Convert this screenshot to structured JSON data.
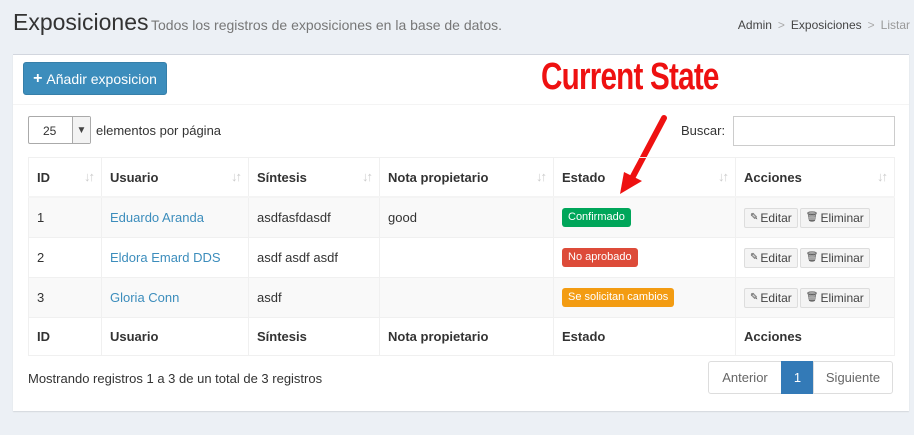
{
  "header": {
    "title": "Exposiciones",
    "subtitle": "Todos los registros de exposiciones en la base de datos.",
    "breadcrumb": [
      "Admin",
      "Exposiciones",
      "Listar"
    ]
  },
  "toolbar": {
    "add_label": "Añadir exposicion"
  },
  "annotation": {
    "text": "Current State",
    "color": "#ee1111"
  },
  "controls": {
    "page_length": "25",
    "page_length_label": "elementos por página",
    "search_label": "Buscar:",
    "search_value": ""
  },
  "table": {
    "columns": [
      "ID",
      "Usuario",
      "Síntesis",
      "Nota propietario",
      "Estado",
      "Acciones"
    ],
    "rows": [
      {
        "id": "1",
        "usuario": "Eduardo Aranda",
        "sintesis": "asdfasfdasdf",
        "nota": "good",
        "estado": "Confirmado",
        "estado_color": "#00a65a"
      },
      {
        "id": "2",
        "usuario": "Eldora Emard DDS",
        "sintesis": "asdf asdf asdf",
        "nota": "",
        "estado": "No aprobado",
        "estado_color": "#dd4b39"
      },
      {
        "id": "3",
        "usuario": "Gloria Conn",
        "sintesis": "asdf",
        "nota": "",
        "estado": "Se solicitan cambios",
        "estado_color": "#f39c12"
      }
    ],
    "edit_label": "Editar",
    "delete_label": "Eliminar"
  },
  "footer": {
    "info": "Mostrando registros 1 a 3 de un total de 3 registros",
    "prev": "Anterior",
    "page": "1",
    "next": "Siguiente"
  }
}
